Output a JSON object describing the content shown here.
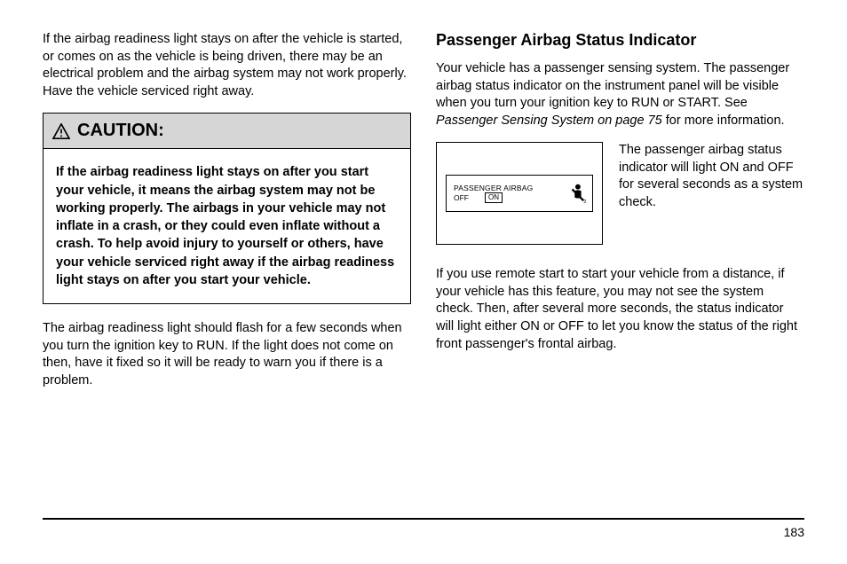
{
  "left": {
    "para1": "If the airbag readiness light stays on after the vehicle is started, or comes on as the vehicle is being driven, there may be an electrical problem and the airbag system may not work properly. Have the vehicle serviced right away.",
    "caution_label": "CAUTION:",
    "caution_body": "If the airbag readiness light stays on after you start your vehicle, it means the airbag system may not be working properly. The airbags in your vehicle may not inflate in a crash, or they could even inflate without a crash. To help avoid injury to yourself or others, have your vehicle serviced right away if the airbag readiness light stays on after you start your vehicle.",
    "para2": "The airbag readiness light should flash for a few seconds when you turn the ignition key to RUN. If the light does not come on then, have it fixed so it will be ready to warn you if there is a problem."
  },
  "right": {
    "heading": "Passenger Airbag Status Indicator",
    "para1a": "Your vehicle has a passenger sensing system. The passenger airbag status indicator on the instrument panel will be visible when you turn your ignition key to RUN or START. See ",
    "para1_ref": "Passenger Sensing System on page 75",
    "para1b": " for more information.",
    "panel_line1": "PASSENGER AIRBAG",
    "panel_off": "OFF",
    "panel_on": "ON",
    "indicator_text": "The passenger airbag status indicator will light ON and OFF for several seconds as a system check.",
    "para2": "If you use remote start to start your vehicle from a distance, if your vehicle has this feature, you may not see the system check. Then, after several more seconds, the status indicator will light either ON or OFF to let you know the status of the right front passenger's frontal airbag."
  },
  "page_number": "183"
}
